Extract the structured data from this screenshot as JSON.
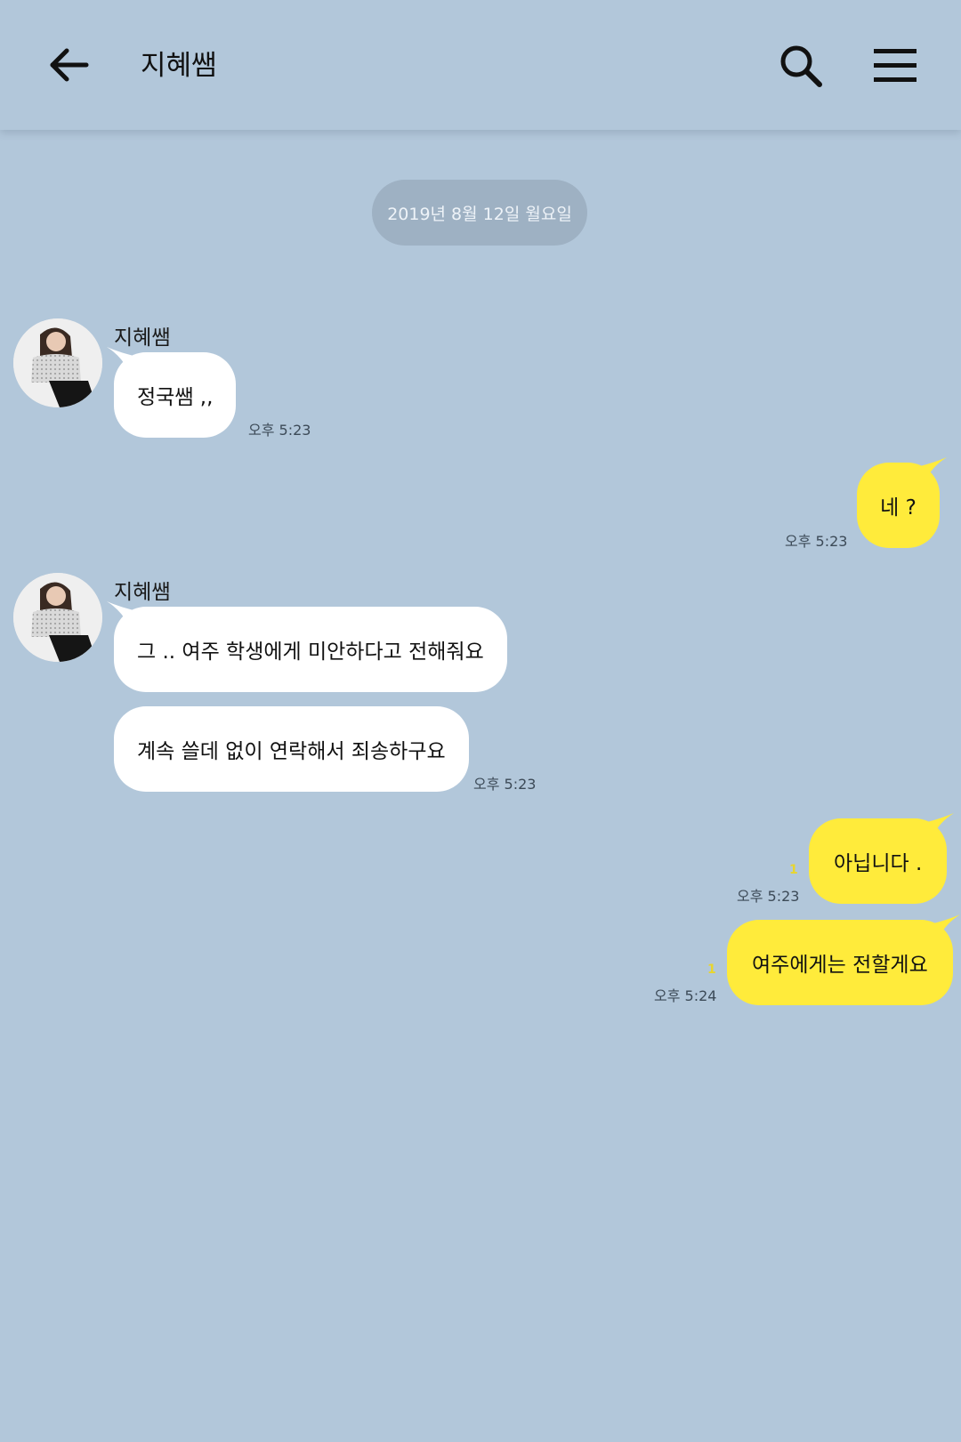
{
  "header": {
    "title": "지혜쌤",
    "back_icon": "arrow-left-icon",
    "search_icon": "search-icon",
    "menu_icon": "hamburger-menu-icon"
  },
  "date_divider": "2019년 8월 12일 월요일",
  "colors": {
    "background": "#b2c7da",
    "sent_bubble": "#ffeb3b",
    "received_bubble": "#ffffff",
    "date_chip": "#9eb1c3"
  },
  "messages": [
    {
      "direction": "received",
      "sender": "지혜쌤",
      "text": "정국쌤 ,,",
      "time": "오후 5:23"
    },
    {
      "direction": "sent",
      "text": "네 ?",
      "time": "오후 5:23"
    },
    {
      "direction": "received",
      "sender": "지혜쌤",
      "text": "그 .. 여주 학생에게 미안하다고 전해줘요"
    },
    {
      "direction": "received",
      "text": "계속 쓸데 없이 연락해서 죄송하구요",
      "time": "오후 5:23"
    },
    {
      "direction": "sent",
      "text": "아닙니다 .",
      "time": "오후 5:23",
      "unread": "1"
    },
    {
      "direction": "sent",
      "text": "여주에게는 전할게요",
      "time": "오후 5:24",
      "unread": "1"
    }
  ]
}
